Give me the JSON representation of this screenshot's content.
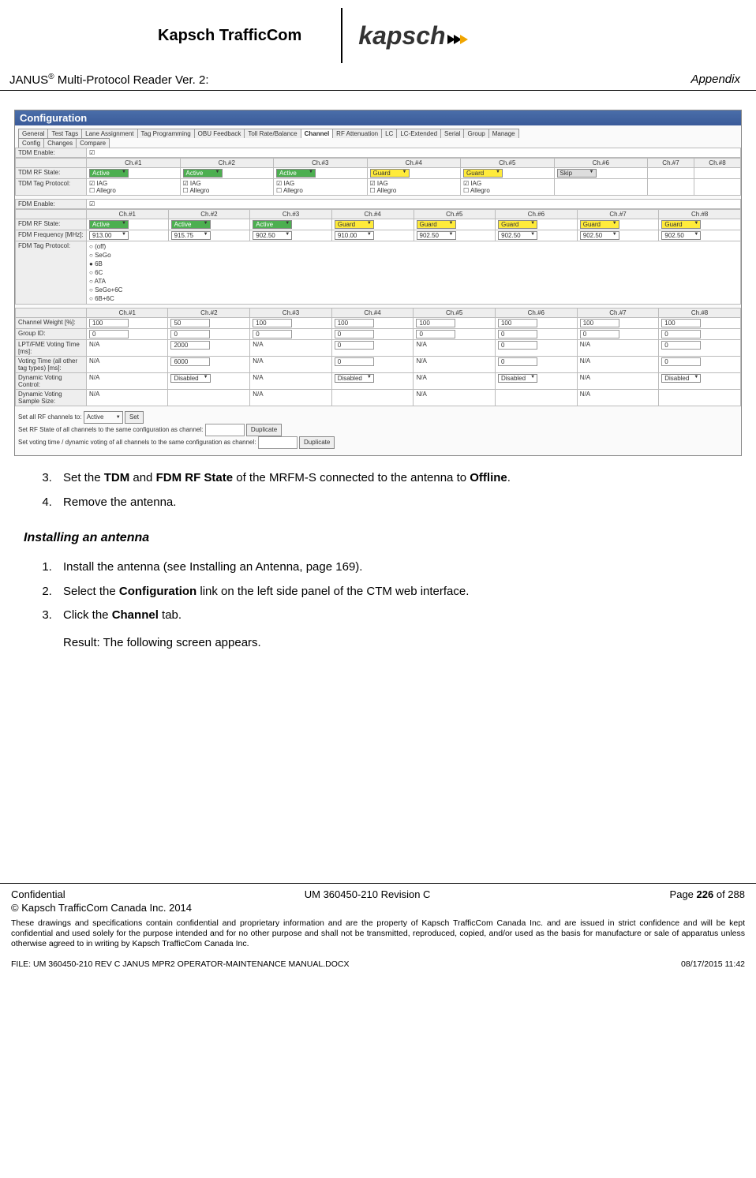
{
  "header": {
    "company": "Kapsch TrafficCom",
    "logo_text": "kapsch",
    "product": "JANUS",
    "product_suffix": " Multi-Protocol Reader Ver. 2:",
    "section": "Appendix"
  },
  "screenshot": {
    "titlebar": "Configuration",
    "tabs_row1": [
      "General",
      "Test Tags",
      "Lane Assignment",
      "Tag Programming",
      "OBU Feedback",
      "Toll Rate/Balance",
      "Channel",
      "RF Attenuation",
      "LC",
      "LC-Extended",
      "Serial",
      "Group",
      "Manage"
    ],
    "tabs_row2": [
      "Config",
      "Changes",
      "Compare"
    ],
    "active_tab": "Channel",
    "tdm_enable_label": "TDM Enable:",
    "tdm_enable_checked": true,
    "ch_headers": [
      "Ch.#1",
      "Ch.#2",
      "Ch.#3",
      "Ch.#4",
      "Ch.#5",
      "Ch.#6",
      "Ch.#7",
      "Ch.#8"
    ],
    "tdm_rf_label": "TDM RF State:",
    "tdm_rf_values": [
      {
        "text": "Active",
        "cls": "green"
      },
      {
        "text": "Active",
        "cls": "green"
      },
      {
        "text": "Active",
        "cls": "green"
      },
      {
        "text": "Guard",
        "cls": "yellow"
      },
      {
        "text": "Guard",
        "cls": "yellow"
      },
      {
        "text": "Skip",
        "cls": "gray"
      },
      null,
      null
    ],
    "tdm_tag_label": "TDM Tag Protocol:",
    "tdm_tag_opts": [
      "IAG",
      "Allegro"
    ],
    "tdm_tag_cols": 5,
    "fdm_enable_label": "FDM Enable:",
    "fdm_enable_checked": true,
    "fdm_rf_label": "FDM RF State:",
    "fdm_rf_values": [
      {
        "text": "Active",
        "cls": "green"
      },
      {
        "text": "Active",
        "cls": "green"
      },
      {
        "text": "Active",
        "cls": "green"
      },
      {
        "text": "Guard",
        "cls": "yellow"
      },
      {
        "text": "Guard",
        "cls": "yellow"
      },
      {
        "text": "Guard",
        "cls": "yellow"
      },
      {
        "text": "Guard",
        "cls": "yellow"
      },
      {
        "text": "Guard",
        "cls": "yellow"
      }
    ],
    "fdm_freq_label": "FDM Frequency [MHz]:",
    "fdm_freq_values": [
      "913.00",
      "915.75",
      "902.50",
      "910.00",
      "902.50",
      "902.50",
      "902.50",
      "902.50"
    ],
    "fdm_tag_label": "FDM Tag Protocol:",
    "fdm_tag_opts": [
      "(off)",
      "SeGo",
      "6B",
      "6C",
      "ATA",
      "SeGo+6C",
      "6B+6C"
    ],
    "fdm_tag_selected": "6B",
    "rows": [
      {
        "label": "Channel Weight [%]:",
        "vals": [
          "100",
          "50",
          "100",
          "100",
          "100",
          "100",
          "100",
          "100"
        ],
        "type": "txt"
      },
      {
        "label": "Group ID:",
        "vals": [
          "0",
          "0",
          "0",
          "0",
          "0",
          "0",
          "0",
          "0"
        ],
        "type": "txt"
      },
      {
        "label": "LPT/FME Voting Time [ms]:",
        "vals": [
          "N/A",
          "2000",
          "N/A",
          "0",
          "N/A",
          "0",
          "N/A",
          "0"
        ],
        "type": "txt"
      },
      {
        "label": "Voting Time (all other tag types) [ms]:",
        "vals": [
          "N/A",
          "6000",
          "N/A",
          "0",
          "N/A",
          "0",
          "N/A",
          "0"
        ],
        "type": "txt"
      },
      {
        "label": "Dynamic Voting Control:",
        "vals": [
          "N/A",
          "Disabled",
          "N/A",
          "Disabled",
          "N/A",
          "Disabled",
          "N/A",
          "Disabled"
        ],
        "type": "sel"
      },
      {
        "label": "Dynamic Voting Sample Size:",
        "vals": [
          "N/A",
          "",
          "N/A",
          "",
          "N/A",
          "",
          "N/A",
          ""
        ],
        "type": "txt"
      }
    ],
    "footer_line1_a": "Set all RF channels to:",
    "footer_line1_sel": "Active",
    "footer_line1_btn": "Set",
    "footer_line2": "Set RF State of all channels to the same configuration as channel:",
    "footer_line3": "Set voting time / dynamic voting of all channels to the same configuration as channel:",
    "footer_dup": "Duplicate"
  },
  "instructions": {
    "step3_pre": "Set the ",
    "step3_b1": "TDM",
    "step3_mid": " and ",
    "step3_b2": "FDM RF State",
    "step3_post": " of the MRFM-S connected to the antenna to ",
    "step3_b3": "Offline",
    "step3_end": ".",
    "step4": "Remove the antenna.",
    "heading": "Installing an antenna",
    "i1": "Install the antenna (see Installing an Antenna, page 169).",
    "i2_pre": "Select the ",
    "i2_b": "Configuration",
    "i2_post": " link on the left side panel of the CTM web interface.",
    "i3_pre": "Click the ",
    "i3_b": "Channel",
    "i3_post": " tab.",
    "i3_result": "Result: The following screen appears."
  },
  "footer": {
    "conf": "Confidential",
    "docid": "UM 360450-210 Revision C",
    "page_pre": "Page ",
    "page_num": "226",
    "page_post": " of 288",
    "copyright": "© Kapsch TrafficCom Canada Inc. 2014",
    "disclaimer": "These drawings and specifications contain confidential and proprietary information and are the property of Kapsch TrafficCom Canada Inc. and are issued in strict confidence and will be kept confidential and used solely for the purpose intended and for no other purpose and shall not be transmitted, reproduced, copied, and/or used as the basis for manufacture or sale of apparatus unless otherwise agreed to in writing by Kapsch TrafficCom Canada Inc.",
    "file": "FILE: UM 360450-210 REV C JANUS MPR2 OPERATOR-MAINTENANCE MANUAL.DOCX",
    "date": "08/17/2015 11:42"
  }
}
